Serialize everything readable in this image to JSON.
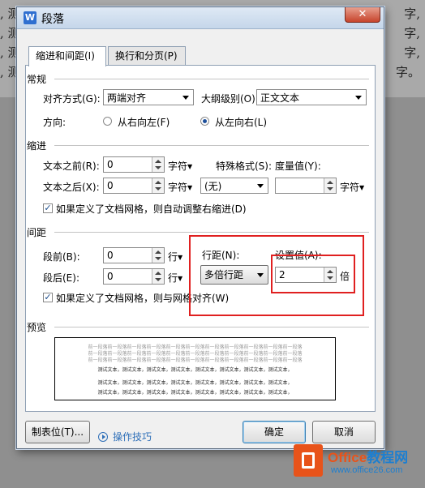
{
  "background": {
    "lines_left": [
      ", 测",
      ", 测",
      ", 测",
      ", 测"
    ],
    "lines_right": [
      "字,",
      "字,",
      "字,",
      "字。"
    ]
  },
  "dialog": {
    "title": "段落",
    "close_glyph": "✕",
    "app_icon_glyph": "W"
  },
  "tabs": [
    {
      "label": "缩进和间距(I)",
      "active": true
    },
    {
      "label": "换行和分页(P)",
      "active": false
    }
  ],
  "general": {
    "section_label": "常规",
    "alignment_label": "对齐方式(G):",
    "alignment_value": "两端对齐",
    "outline_label": "大纲级别(O):",
    "outline_value": "正文文本",
    "direction_label": "方向:",
    "rtl_label": "从右向左(F)",
    "ltr_label": "从左向右(L)",
    "selected_direction": "ltr"
  },
  "indent": {
    "section_label": "缩进",
    "before_label": "文本之前(R):",
    "before_value": "0",
    "before_unit": "字符",
    "after_label": "文本之后(X):",
    "after_value": "0",
    "after_unit": "字符",
    "special_label": "特殊格式(S):",
    "special_value": "(无)",
    "measure_label": "度量值(Y):",
    "measure_value": "",
    "measure_unit": "字符",
    "auto_adjust_label": "如果定义了文档网格，则自动调整右缩进(D)",
    "auto_adjust_checked": true
  },
  "spacing": {
    "section_label": "间距",
    "before_label": "段前(B):",
    "before_value": "0",
    "before_unit": "行",
    "after_label": "段后(E):",
    "after_value": "0",
    "after_unit": "行",
    "line_spacing_label": "行距(N):",
    "line_spacing_value": "多倍行距",
    "set_value_label": "设置值(A):",
    "set_value": "2",
    "set_value_unit": "倍",
    "snap_grid_label": "如果定义了文档网格，则与网格对齐(W)",
    "snap_grid_checked": true
  },
  "preview": {
    "section_label": "预览",
    "gray_line": "前一段落前一段落前一段落前一段落前一段落前一段落前一段落前一段落前一段落前一段落前一段落",
    "text_line": "测试文本，测试文本，测试文本，测试文本，测试文本，测试文本，测试文本，测试文本，"
  },
  "buttons": {
    "tabs_label": "制表位(T)...",
    "tips_label": "操作技巧",
    "ok_label": "确定",
    "cancel_label": "取消"
  },
  "watermark": {
    "brand_part1": "Office",
    "brand_part2": "教程网",
    "url": "www.office26.com"
  },
  "colors": {
    "highlight_box": "#e02020",
    "link": "#2e6fb8",
    "watermark_orange": "#e8531a"
  }
}
